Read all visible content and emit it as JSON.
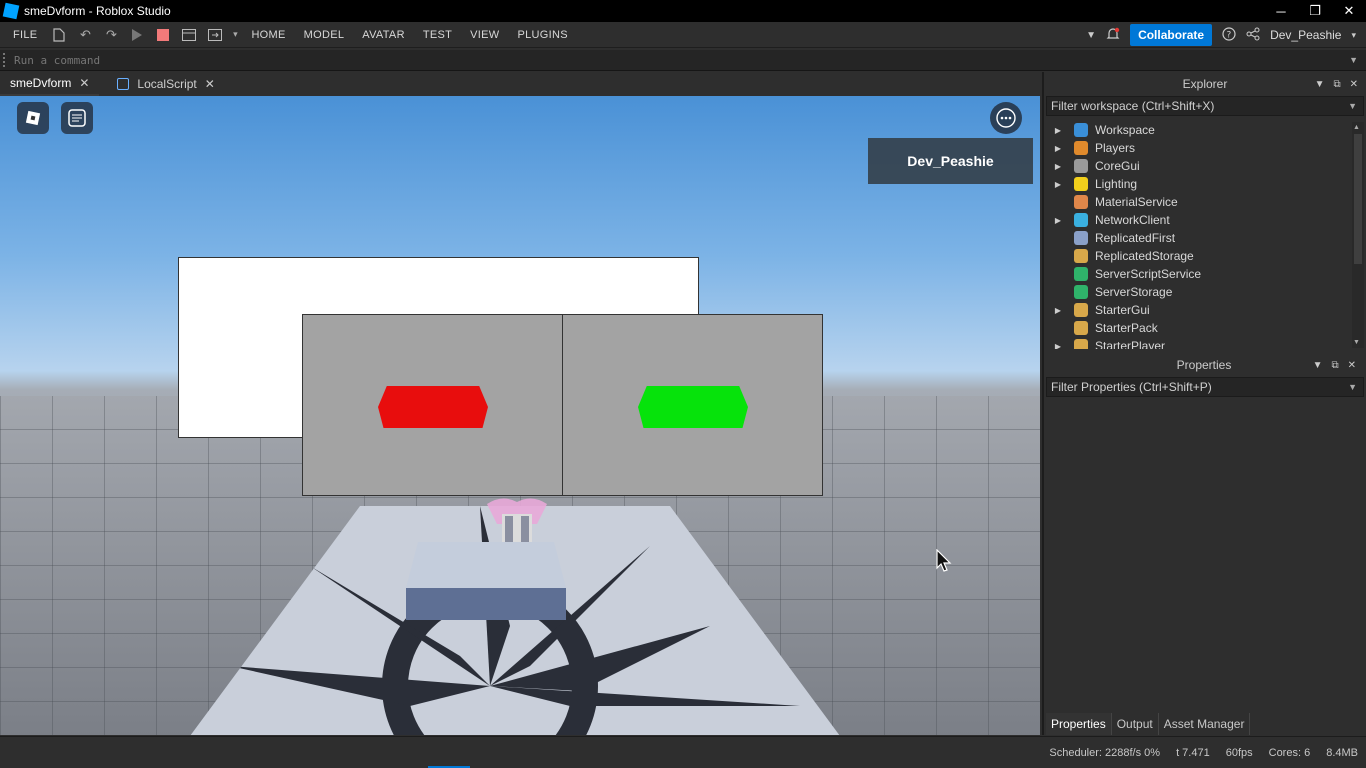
{
  "window": {
    "title": "smeDvform - Roblox Studio",
    "controls": [
      "─",
      "❐",
      "✕"
    ]
  },
  "menubar": {
    "file": "FILE",
    "tabs": [
      "HOME",
      "MODEL",
      "AVATAR",
      "TEST",
      "VIEW",
      "PLUGINS"
    ],
    "collaborate": "Collaborate",
    "user": "Dev_Peashie"
  },
  "command": {
    "placeholder": "Run a command"
  },
  "doc_tabs": [
    {
      "label": "smeDvform"
    },
    {
      "label": "LocalScript"
    }
  ],
  "viewport": {
    "player_name": "Dev_Peashie",
    "red_button_color": "#e80d0d",
    "green_button_color": "#06e30b"
  },
  "explorer": {
    "title": "Explorer",
    "filter_placeholder": "Filter workspace (Ctrl+Shift+X)",
    "items": [
      {
        "label": "Workspace",
        "expandable": true,
        "icon": "globe-icon",
        "color": "#3a8fd8"
      },
      {
        "label": "Players",
        "expandable": true,
        "icon": "players-icon",
        "color": "#e08a2c"
      },
      {
        "label": "CoreGui",
        "expandable": true,
        "icon": "window-icon",
        "color": "#9a9a9a"
      },
      {
        "label": "Lighting",
        "expandable": true,
        "icon": "bulb-icon",
        "color": "#f2d01c"
      },
      {
        "label": "MaterialService",
        "expandable": false,
        "icon": "material-icon",
        "color": "#e0874a"
      },
      {
        "label": "NetworkClient",
        "expandable": true,
        "icon": "network-icon",
        "color": "#3ab0e0"
      },
      {
        "label": "ReplicatedFirst",
        "expandable": false,
        "icon": "replicated-first-icon",
        "color": "#8aa0c8"
      },
      {
        "label": "ReplicatedStorage",
        "expandable": false,
        "icon": "replicated-storage-icon",
        "color": "#d8a84a"
      },
      {
        "label": "ServerScriptService",
        "expandable": false,
        "icon": "server-script-icon",
        "color": "#2fb36a"
      },
      {
        "label": "ServerStorage",
        "expandable": false,
        "icon": "server-storage-icon",
        "color": "#2fb36a"
      },
      {
        "label": "StarterGui",
        "expandable": true,
        "icon": "starter-gui-icon",
        "color": "#d8a84a"
      },
      {
        "label": "StarterPack",
        "expandable": false,
        "icon": "starter-pack-icon",
        "color": "#d8a84a"
      },
      {
        "label": "StarterPlayer",
        "expandable": true,
        "icon": "starter-player-icon",
        "color": "#d8a84a"
      }
    ]
  },
  "properties": {
    "title": "Properties",
    "filter_placeholder": "Filter Properties (Ctrl+Shift+P)"
  },
  "bottom_tabs": [
    "Properties",
    "Output",
    "Asset Manager"
  ],
  "status": {
    "scheduler": "Scheduler: 2288f/s 0%",
    "time": "t 7.471",
    "fps": "60fps",
    "cores": "Cores: 6",
    "memory": "8.4MB"
  }
}
